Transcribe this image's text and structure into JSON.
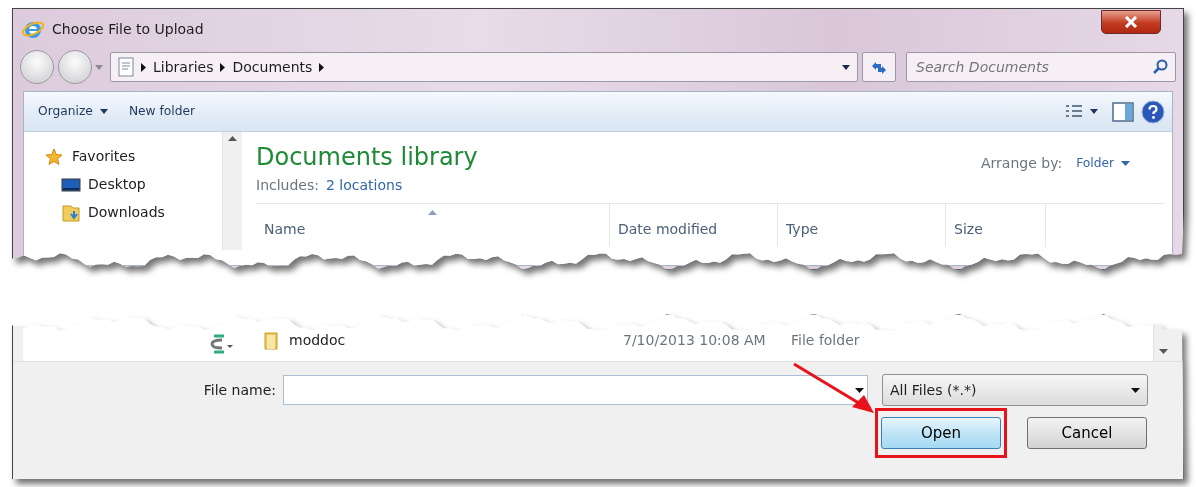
{
  "window": {
    "title": "Choose File to Upload"
  },
  "address_bar": {
    "crumbs": [
      "Libraries",
      "Documents"
    ]
  },
  "search": {
    "placeholder": "Search Documents"
  },
  "toolbar": {
    "items": [
      {
        "label": "Organize",
        "kind": "menu"
      },
      {
        "label": "New folder",
        "kind": "button"
      }
    ]
  },
  "navigation": {
    "items": [
      {
        "label": "Favorites",
        "kind": "favorites"
      },
      {
        "label": "Desktop",
        "kind": "desktop"
      },
      {
        "label": "Downloads",
        "kind": "downloads"
      }
    ]
  },
  "library": {
    "title": "Documents library",
    "includes_label": "Includes:",
    "includes_link": "2 locations",
    "arrange_label": "Arrange by:",
    "arrange_value": "Folder"
  },
  "columns": [
    {
      "label": "Name",
      "sorted": true
    },
    {
      "label": "Date modified",
      "sorted": false
    },
    {
      "label": "Type",
      "sorted": false
    },
    {
      "label": "Size",
      "sorted": false
    }
  ],
  "rows": [
    {
      "name": "moddoc",
      "date": "7/10/2013 10:08 AM",
      "type": "File folder"
    }
  ],
  "file_name": {
    "label": "File name:"
  },
  "file_type": {
    "value": "All Files (*.*)"
  },
  "buttons": [
    {
      "label": "Open",
      "highlighted": true
    },
    {
      "label": "Cancel",
      "highlighted": false
    }
  ]
}
